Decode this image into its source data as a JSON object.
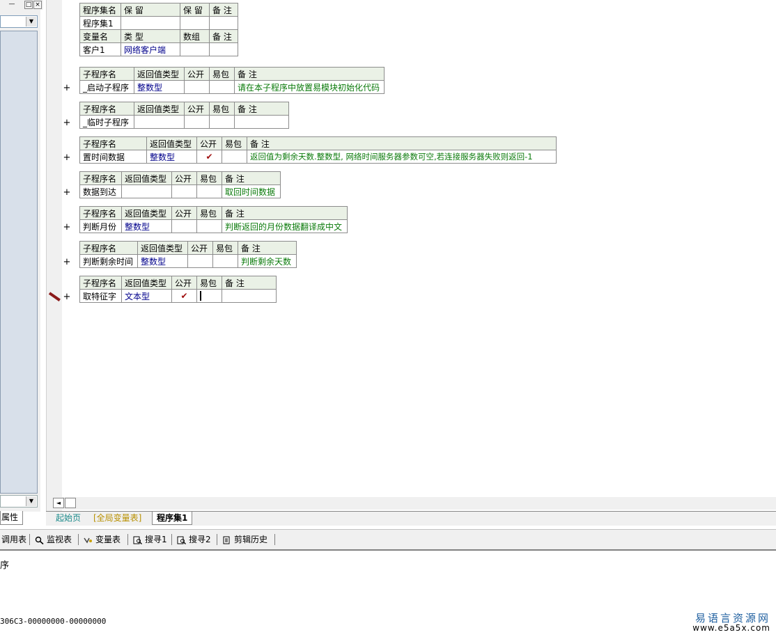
{
  "left_panel": {
    "min_glyph": "—",
    "max_glyph": "□",
    "close_glyph": "×",
    "dropdown_glyph": "▼",
    "properties_tab": "属性"
  },
  "assembly_table": {
    "header1": [
      "程序集名",
      "保 留",
      "保 留",
      "备 注"
    ],
    "row1": [
      "程序集1",
      "",
      "",
      ""
    ],
    "header2": [
      "变量名",
      "类 型",
      "数组",
      "备 注"
    ],
    "row2": [
      "客户1",
      "网络客户端",
      "",
      ""
    ]
  },
  "subroutine_header": {
    "name": "子程序名",
    "return_type": "返回值类型",
    "public": "公开",
    "easy_pack": "易包",
    "note": "备 注"
  },
  "subroutines": [
    {
      "name": "_启动子程序",
      "return_type": "整数型",
      "public": "",
      "note": "请在本子程序中放置易模块初始化代码"
    },
    {
      "name": "_临时子程序",
      "return_type": "",
      "public": "",
      "note": ""
    },
    {
      "name": "置时间数据",
      "return_type": "整数型",
      "public": "✔",
      "note": "返回值为剩余天数.整数型, 网络时间服务器参数可空,若连接服务器失败则返回-1"
    },
    {
      "name": "数据到达",
      "return_type": "",
      "public": "",
      "note": "取回时间数据"
    },
    {
      "name": "判断月份",
      "return_type": "整数型",
      "public": "",
      "note": "判断返回的月份数据翻译成中文"
    },
    {
      "name": "判断剩余时间",
      "return_type": "整数型",
      "public": "",
      "note": "判断剩余天数"
    },
    {
      "name": "取特征字",
      "return_type": "文本型",
      "public": "✔",
      "note": ""
    }
  ],
  "plus_glyph": "+",
  "scroll_left_glyph": "◄",
  "tabs": [
    "起始页",
    "[全局变量表]",
    "程序集1"
  ],
  "toolbar": [
    "调用表",
    "监视表",
    "变量表",
    "搜寻1",
    "搜寻2",
    "剪辑历史"
  ],
  "output_text": "序",
  "status_text": "306C3-00000000-00000000",
  "watermark": {
    "title": "易语言资源网",
    "url": "www.e5a5x.com"
  }
}
